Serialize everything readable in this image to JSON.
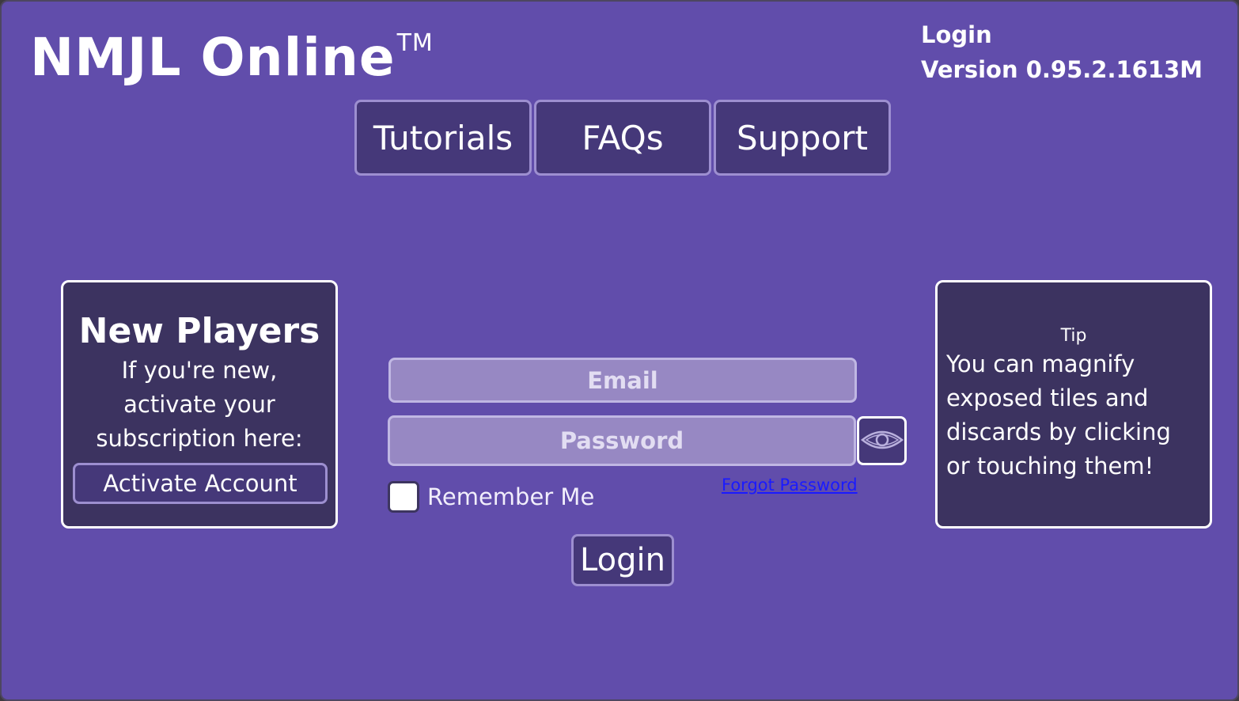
{
  "header": {
    "brand": "NMJL Online",
    "trademark": "TM",
    "screen_name": "Login",
    "version": "Version 0.95.2.1613M"
  },
  "nav": {
    "tutorials": "Tutorials",
    "faqs": "FAQs",
    "support": "Support"
  },
  "new_players": {
    "title": "New Players",
    "line1": "If you're new,",
    "line2": "activate your",
    "line3": "subscription here:",
    "button": "Activate Account"
  },
  "login_form": {
    "email_placeholder": "Email",
    "email_value": "",
    "password_placeholder": "Password",
    "password_value": "",
    "remember_me": "Remember Me",
    "remember_checked": false,
    "forgot_password": "Forgot Password",
    "login_button": "Login",
    "show_password_icon": "eye-icon"
  },
  "tip": {
    "label": "Tip",
    "line1": "You can magnify",
    "line2": "exposed tiles and",
    "line3": "discards by clicking",
    "line4": "or touching them!"
  },
  "colors": {
    "background": "#614dab",
    "button_fill": "#453879",
    "button_border": "#9d8fd0",
    "panel_fill": "#3c3360",
    "input_fill": "#9788c3",
    "link": "#1a1aff"
  }
}
